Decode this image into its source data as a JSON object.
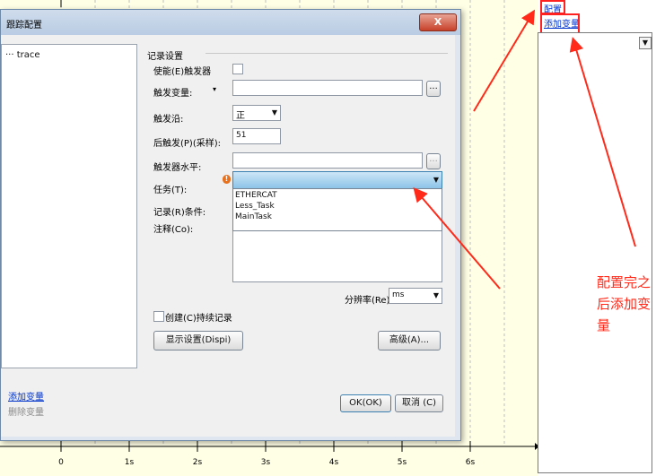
{
  "chart": {
    "x_ticks": [
      "0",
      "1s",
      "2s",
      "3s",
      "4s",
      "5s",
      "6s"
    ],
    "colors": {
      "background": "#ffffe6",
      "grid": "#bdbdbd",
      "axis": "#000000"
    }
  },
  "right_panel": {
    "config_link": "配置",
    "add_variable_link": "添加变量"
  },
  "dialog": {
    "title": "跟踪配置",
    "close_label": "X",
    "tree": {
      "item": "trace"
    },
    "add_variable": "添加变量",
    "delete_variable": "删除变量",
    "group_title": "记录设置",
    "enable_trigger_label": "使能(E)触发器",
    "trigger_variable_label": "触发变量:",
    "trigger_variable_dropdown": "▾",
    "browse_button": "...",
    "trigger_edge_label": "触发沿:",
    "trigger_edge_value": "正",
    "post_trigger_label": "后触发(P)(采样):",
    "post_trigger_value": "51",
    "trigger_level_label": "触发器水平:",
    "task_label": "任务(T):",
    "task_options": [
      "ETHERCAT",
      "Less_Task",
      "MainTask"
    ],
    "record_condition_label": "记录(R)条件:",
    "comment_label": "注释(Co):",
    "resolution_label": "分辨率(Re):",
    "resolution_value": "ms",
    "create_persistent_label": "创建(C)持续记录",
    "display_settings_button": "显示设置(Dispi)",
    "advanced_button": "高级(A)...",
    "ok_button": "OK(OK)",
    "cancel_button": "取消 (C)"
  },
  "annotation": {
    "text": "配置完之后添加变量",
    "color": "#ff2a1a"
  }
}
